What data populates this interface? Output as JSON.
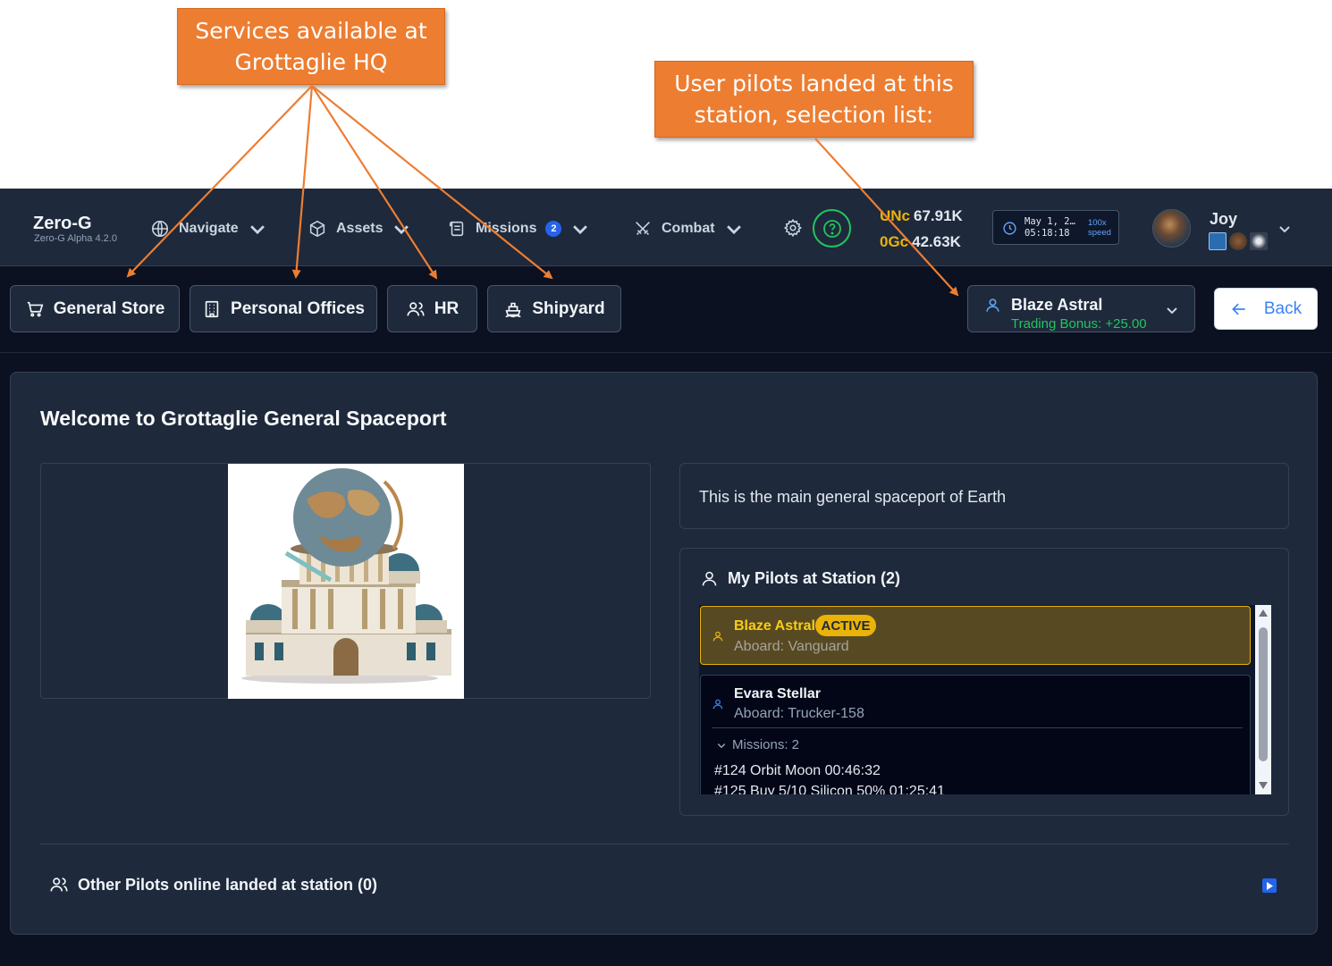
{
  "annotations": {
    "services": "Services available at\nGrottaglie HQ",
    "pilots": "User pilots landed at this\nstation, selection list:"
  },
  "navbar": {
    "brand": "Zero-G",
    "version": "Zero-G Alpha 4.2.0",
    "navigate": "Navigate",
    "assets": "Assets",
    "missions": "Missions",
    "missions_badge": "2",
    "combat": "Combat",
    "currency1_label": "UNc",
    "currency1_value": "67.91K",
    "currency2_label": "0Gc",
    "currency2_value": "42.63K",
    "date": "May 1, 2…",
    "time": "05:18:18",
    "speed": "100x",
    "speed_label": "speed",
    "user": "Joy"
  },
  "toolbar": {
    "general_store": "General Store",
    "personal_offices": "Personal Offices",
    "hr": "HR",
    "shipyard": "Shipyard",
    "back": "Back"
  },
  "pilot_select": {
    "name": "Blaze Astral",
    "bonus": "Trading Bonus: +25.00"
  },
  "main": {
    "title": "Welcome to Grottaglie General Spaceport",
    "description": "This is the main general spaceport of Earth",
    "pilots_title": "My Pilots at Station (2)",
    "pilots": [
      {
        "name": "Blaze Astral",
        "badge": "ACTIVE",
        "aboard": "Aboard: Vanguard"
      },
      {
        "name": "Evara Stellar",
        "aboard": "Aboard: Trucker-158",
        "missions_label": "Missions: 2",
        "missions": [
          "#124 Orbit Moon 00:46:32",
          "#125 Buy 5/10 Silicon 50% 01:25:41"
        ]
      }
    ],
    "other_pilots": "Other Pilots online landed at station (0)"
  },
  "colors": {
    "accent": "#ed7d31",
    "gold": "#eab308",
    "green": "#22c55e",
    "blue": "#3b82f6"
  }
}
